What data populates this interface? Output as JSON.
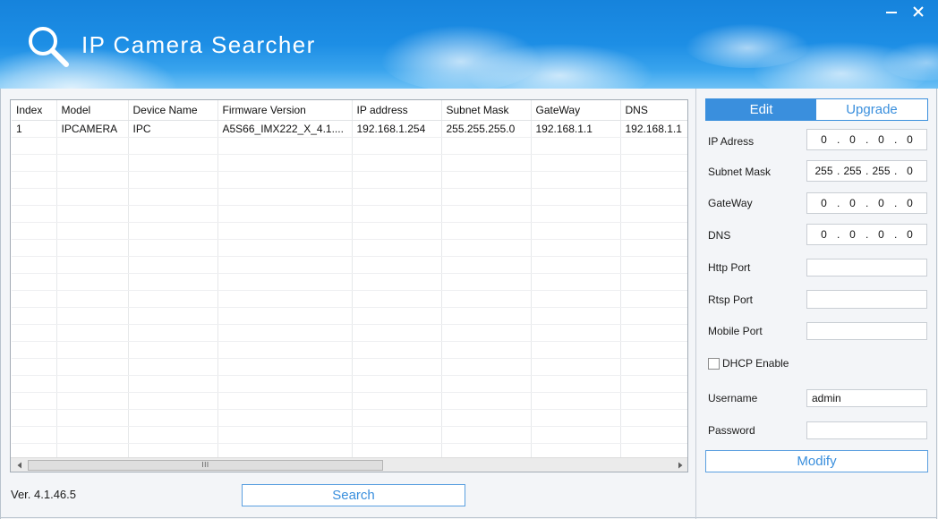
{
  "window": {
    "title": "IP Camera Searcher",
    "app_icon": "magnifier-icon",
    "minimize_icon": "minimize-icon",
    "close_icon": "close-icon"
  },
  "colors": {
    "accent": "#3a8fdd",
    "header_top": "#1683dc",
    "header_bottom": "#4db3f3",
    "panel_background": "#f3f5f8"
  },
  "device_table": {
    "columns": [
      "Index",
      "Model",
      "Device Name",
      "Firmware Version",
      "IP address",
      "Subnet Mask",
      "GateWay",
      "DNS"
    ],
    "rows": [
      [
        "1",
        "IPCAMERA",
        "IPC",
        "A5S66_IMX222_X_4.1....",
        "192.168.1.254",
        "255.255.255.0",
        "192.168.1.1",
        "192.168.1.1"
      ]
    ],
    "scrollbar": {
      "left_icon": "arrow-left-icon",
      "right_icon": "arrow-right-icon",
      "grip": "III"
    }
  },
  "footer": {
    "version": "Ver. 4.1.46.5",
    "search_label": "Search"
  },
  "edit_panel": {
    "tabs": [
      {
        "label": "Edit",
        "active": true
      },
      {
        "label": "Upgrade",
        "active": false
      }
    ],
    "octet_separator": ".",
    "ip_address": {
      "label": "IP Adress",
      "octets": [
        "0",
        "0",
        "0",
        "0"
      ]
    },
    "subnet_mask": {
      "label": "Subnet Mask",
      "octets": [
        "255",
        "255",
        "255",
        "0"
      ]
    },
    "gateway": {
      "label": "GateWay",
      "octets": [
        "0",
        "0",
        "0",
        "0"
      ]
    },
    "dns": {
      "label": "DNS",
      "octets": [
        "0",
        "0",
        "0",
        "0"
      ]
    },
    "http_port": {
      "label": "Http Port",
      "value": ""
    },
    "rtsp_port": {
      "label": "Rtsp Port",
      "value": ""
    },
    "mobile_port": {
      "label": "Mobile Port",
      "value": ""
    },
    "dhcp": {
      "label": "DHCP Enable",
      "checked": false
    },
    "username": {
      "label": "Username",
      "value": "admin"
    },
    "password": {
      "label": "Password",
      "value": ""
    },
    "modify_label": "Modify"
  }
}
